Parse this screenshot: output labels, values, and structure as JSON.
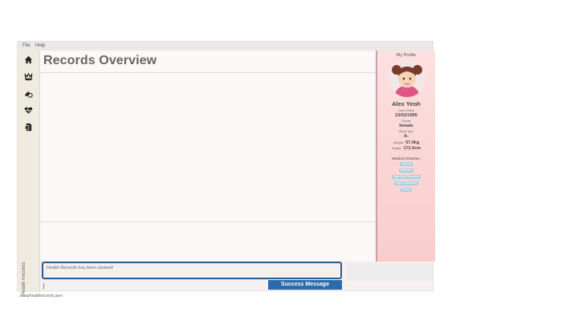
{
  "menu": {
    "file": "File",
    "help": "Help"
  },
  "sidebar": {
    "items": [
      {
        "icon": "home-icon"
      },
      {
        "icon": "crown-icon"
      },
      {
        "icon": "pills-icon"
      },
      {
        "icon": "heartbeat-icon"
      },
      {
        "icon": "document-icon"
      }
    ],
    "vertical_label": "Health Records"
  },
  "main": {
    "title": "Records Overview"
  },
  "profile": {
    "heading": "My Profile",
    "name": "Alex Yeoh",
    "dob_label": "Date of Birth",
    "dob": "23/02/1995",
    "gender_label": "Gender",
    "gender": "female",
    "blood_label": "Blood Type",
    "blood": "A-",
    "weight_label": "Weight:",
    "weight": "57.0kg",
    "height_label": "Height:",
    "height": "172.0cm",
    "histories_label": "Medical Histories:",
    "histories": [
      "Asthma",
      "Diabetes",
      "High Blood Pressure",
      "High Cholesterol",
      "Stroke"
    ]
  },
  "result": {
    "message": "Health Records has been cleared!"
  },
  "success_button": "Success Message",
  "status_bar": {
    "path": "./data/healthrecords.json"
  }
}
